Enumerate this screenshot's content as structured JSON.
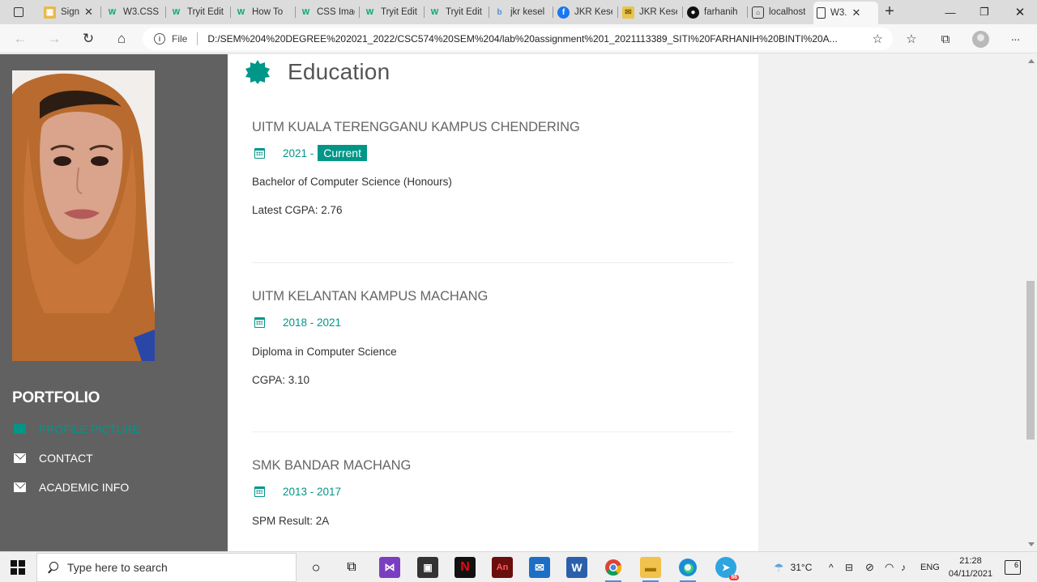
{
  "browser": {
    "tabs": [
      {
        "label": "Sign",
        "icon": "google-sheets-icon",
        "color": "#d9a33a"
      },
      {
        "label": "W3.CSS",
        "icon": "w3schools-icon",
        "color": "#04aa6d"
      },
      {
        "label": "Tryit Edit",
        "icon": "w3schools-icon",
        "color": "#04aa6d"
      },
      {
        "label": "How To",
        "icon": "w3schools-icon",
        "color": "#04aa6d"
      },
      {
        "label": "CSS Imag",
        "icon": "w3schools-icon",
        "color": "#04aa6d"
      },
      {
        "label": "Tryit Edit",
        "icon": "w3schools-icon",
        "color": "#04aa6d"
      },
      {
        "label": "Tryit Edit",
        "icon": "w3schools-icon",
        "color": "#04aa6d"
      },
      {
        "label": "jkr kesel",
        "icon": "bing-icon",
        "color": "#4a8fd8"
      },
      {
        "label": "JKR Kese",
        "icon": "facebook-icon",
        "color": "#1877f2"
      },
      {
        "label": "JKR Kese",
        "icon": "mail-icon",
        "color": "#c9a227"
      },
      {
        "label": "farhanih",
        "icon": "github-icon",
        "color": "#111111"
      },
      {
        "label": "localhost",
        "icon": "page-icon",
        "color": "#333333"
      },
      {
        "label": "W3.",
        "icon": "document-icon",
        "color": "#333333"
      }
    ],
    "address_label": "File",
    "url": "D:/SEM%204%20DEGREE%202021_2022/CSC574%20SEM%204/lab%20assignment%201_2021113389_SITI%20FARHANIH%20BINTI%20A..."
  },
  "sidebar": {
    "title": "PORTFOLIO",
    "items": [
      {
        "label": "PROFILE PICTURE",
        "icon": "image-icon"
      },
      {
        "label": "CONTACT",
        "icon": "envelope-icon"
      },
      {
        "label": "ACADEMIC INFO",
        "icon": "envelope-icon"
      }
    ]
  },
  "education": {
    "heading": "Education",
    "entries": [
      {
        "school": "UITM KUALA TERENGGANU KAMPUS CHENDERING",
        "date": "2021 -",
        "badge": "Current",
        "program": "Bachelor of Computer Science (Honours)",
        "result": "Latest CGPA: 2.76"
      },
      {
        "school": "UITM KELANTAN KAMPUS MACHANG",
        "date": "2018 - 2021",
        "program": "Diploma in Computer Science",
        "result": "CGPA: 3.10"
      },
      {
        "school": "SMK BANDAR MACHANG",
        "date": "2013 - 2017",
        "program": "SPM Result: 2A"
      }
    ]
  },
  "taskbar": {
    "search_placeholder": "Type here to search",
    "weather": "31°C",
    "language": "ENG",
    "time": "21:28",
    "date": "04/11/2021",
    "notifications": "6",
    "telegram_badge": "86"
  },
  "colors": {
    "accent": "#009688",
    "sidebar_bg": "#616161"
  }
}
